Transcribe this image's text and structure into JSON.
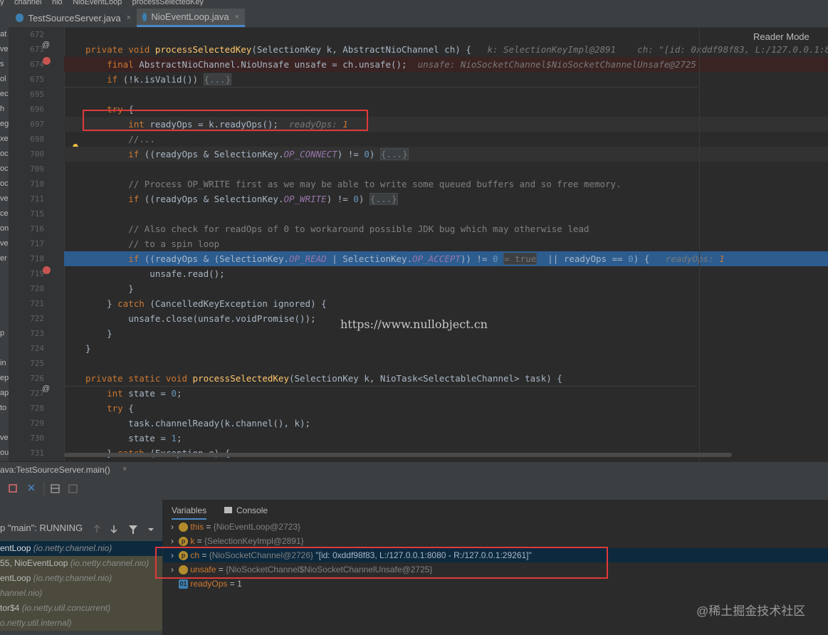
{
  "breadcrumb": [
    "y",
    "channel",
    "nio",
    "NioEventLoop",
    "processSelectedKey"
  ],
  "tabs": [
    {
      "label": "TestSourceServer.java",
      "close": "×"
    },
    {
      "label": "NioEventLoop.java",
      "close": "×"
    }
  ],
  "reader_mode": "Reader Mode",
  "left_strip": [
    "at",
    "ve",
    "s",
    "ol",
    "ec",
    "h",
    "eg",
    "xe",
    "ocl",
    "ocl",
    "ocl",
    "ve",
    "ce",
    "on",
    "ven",
    "er",
    "",
    "",
    "",
    "",
    "p",
    "",
    "in",
    "ep",
    "ap",
    "to",
    "",
    "ve",
    "ou",
    "el"
  ],
  "code_lines": [
    {
      "ln": "672",
      "html": ""
    },
    {
      "ln": "673",
      "html": "<span class=\"kw\">private void </span><span class=\"fn\">processSelectedKey</span>(SelectionKey k, AbstractNioChannel ch) {   <span class=\"hint\">k: SelectionKeyImpl@2891    ch: \"[id: 0xddf98f83, L:/127.0.0.1:8080 - R:/127.0.0</span>"
    },
    {
      "ln": "674",
      "html": "    <span class=\"kw\">final </span>AbstractNioChannel.NioUnsafe unsafe = ch.unsafe();  <span class=\"hint\">unsafe: NioSocketChannel$NioSocketChannelUnsafe@2725</span>"
    },
    {
      "ln": "675",
      "html": "    <span class=\"kw\">if </span>(!k.isValid()) <span class=\"fold\">{...}</span>"
    },
    {
      "ln": "695",
      "html": ""
    },
    {
      "ln": "696",
      "html": "    <span class=\"kw\">try </span>{"
    },
    {
      "ln": "697",
      "html": "        <span class=\"kw\">int </span>readyOps = k.readyOps();  <span class=\"hint\">readyOps: </span><span class=\"hintv\">1</span>"
    },
    {
      "ln": "698",
      "html": "        <span class=\"cm\">//...</span>"
    },
    {
      "ln": "700",
      "html": "        <span class=\"kw\">if </span>((readyOps &amp; SelectionKey.<span class=\"it\">OP_CONNECT</span>) != <span class=\"num\">0</span>) <span class=\"fold\">{...}</span>"
    },
    {
      "ln": "709",
      "html": ""
    },
    {
      "ln": "710",
      "html": "        <span class=\"cm\">// Process OP_WRITE first as we may be able to write some queued buffers and so free memory.</span>"
    },
    {
      "ln": "711",
      "html": "        <span class=\"kw\">if </span>((readyOps &amp; SelectionKey.<span class=\"it\">OP_WRITE</span>) != <span class=\"num\">0</span>) <span class=\"fold\">{...}</span>"
    },
    {
      "ln": "715",
      "html": ""
    },
    {
      "ln": "716",
      "html": "        <span class=\"cm\">// Also check for readOps of 0 to workaround possible JDK bug which may otherwise lead</span>"
    },
    {
      "ln": "717",
      "html": "        <span class=\"cm\">// to a spin loop</span>"
    },
    {
      "ln": "718",
      "html": "        <span class=\"kw\">if </span>((readyOps &amp; (SelectionKey.<span class=\"it\">OP_READ</span> | SelectionKey.<span class=\"it\">OP_ACCEPT</span>)) != <span class=\"num\">0</span> <span class=\"fold\">= true</span>  || readyOps == <span class=\"num\">0</span>) {   <span class=\"hint\">readyOps: </span><span class=\"hintv\">1</span>"
    },
    {
      "ln": "719",
      "html": "            unsafe.read();"
    },
    {
      "ln": "720",
      "html": "        }"
    },
    {
      "ln": "721",
      "html": "    } <span class=\"kw\">catch </span>(CancelledKeyException ignored) {"
    },
    {
      "ln": "722",
      "html": "        unsafe.close(unsafe.voidPromise());"
    },
    {
      "ln": "723",
      "html": "    }"
    },
    {
      "ln": "724",
      "html": "}"
    },
    {
      "ln": "725",
      "html": ""
    },
    {
      "ln": "726",
      "html": "<span class=\"kw\">private static void </span><span class=\"fn\">processSelectedKey</span>(SelectionKey k, NioTask&lt;SelectableChannel&gt; task) {"
    },
    {
      "ln": "727",
      "html": "    <span class=\"kw\">int </span>state = <span class=\"num\">0</span>;"
    },
    {
      "ln": "728",
      "html": "    <span class=\"kw\">try </span>{"
    },
    {
      "ln": "729",
      "html": "        task.channelReady(k.channel(), k);"
    },
    {
      "ln": "730",
      "html": "        state = <span class=\"num\">1</span>;"
    },
    {
      "ln": "731",
      "html": "    } <span class=\"kw\">catch </span>(Exception e) {"
    }
  ],
  "watermark": "https://www.nullobject.cn",
  "debug": {
    "session_tab": "ava:TestSourceServer.main()",
    "session_close": "×",
    "thread_status": "p \"main\": RUNNING",
    "tabs": {
      "variables": "Variables",
      "console": "Console"
    },
    "frames": [
      {
        "name": "entLoop",
        "pkg": "(io.netty.channel.nio)"
      },
      {
        "name": "55, NioEventLoop",
        "pkg": "(io.netty.channel.nio)"
      },
      {
        "name": "entLoop",
        "pkg": "(io.netty.channel.nio)"
      },
      {
        "name": "",
        "pkg": "hannel.nio)"
      },
      {
        "name": "tor$4",
        "pkg": "(io.netty.util.concurrent)"
      },
      {
        "name": "",
        "pkg": "o.netty.util.internal)"
      }
    ],
    "variables": [
      {
        "icon": "",
        "name": "this",
        "eq": " = ",
        "val": "{NioEventLoop@2723}",
        "str": ""
      },
      {
        "icon": "p",
        "name": "k",
        "eq": " = ",
        "val": "{SelectionKeyImpl@2891}",
        "str": ""
      },
      {
        "icon": "p",
        "name": "ch",
        "eq": " = ",
        "val": "{NioSocketChannel@2726}",
        "str": " \"[id: 0xddf98f83, L:/127.0.0.1:8080 - R:/127.0.0.1:29261]\""
      },
      {
        "icon": "",
        "name": "unsafe",
        "eq": " = ",
        "val": "{NioSocketChannel$NioSocketChannelUnsafe@2725}",
        "str": ""
      },
      {
        "icon": "01",
        "name": "readyOps",
        "eq": " = ",
        "val": "1",
        "str": ""
      }
    ]
  },
  "juejin_watermark": "@稀土掘金技术社区",
  "colors": {
    "accent": "#4a88c7",
    "highlight_line": "#2d5c8f",
    "breakpoint_line": "#3a2323",
    "annotation": "#e0393a"
  }
}
